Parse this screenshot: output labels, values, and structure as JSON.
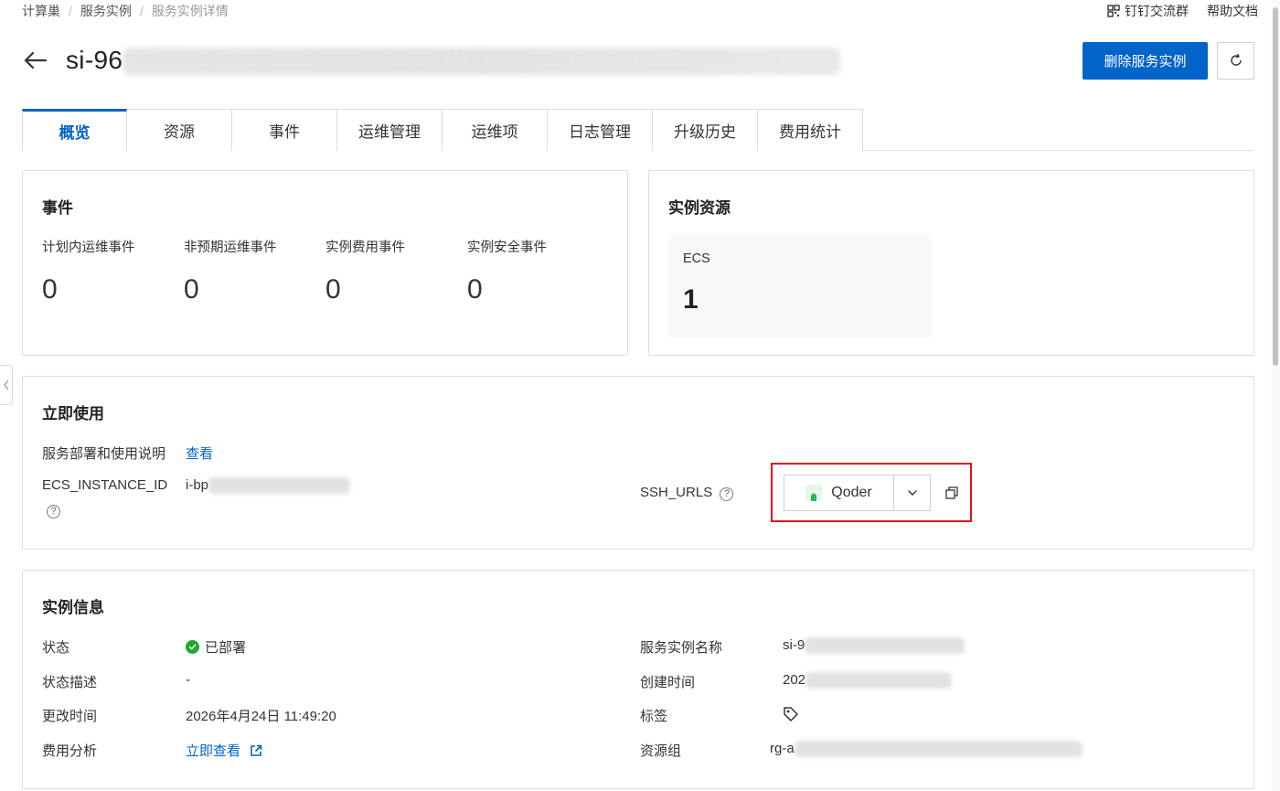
{
  "breadcrumb": {
    "items": [
      "计算巢",
      "服务实例",
      "服务实例详情"
    ]
  },
  "top_links": {
    "dingtalk": "钉钉交流群",
    "help": "帮助文档"
  },
  "header": {
    "title_prefix": "si-96",
    "delete_button": "删除服务实例"
  },
  "tabs": [
    "概览",
    "资源",
    "事件",
    "运维管理",
    "运维项",
    "日志管理",
    "升级历史",
    "费用统计"
  ],
  "events_card": {
    "title": "事件",
    "stats": [
      {
        "label": "计划内运维事件",
        "value": "0"
      },
      {
        "label": "非预期运维事件",
        "value": "0"
      },
      {
        "label": "实例费用事件",
        "value": "0"
      },
      {
        "label": "实例安全事件",
        "value": "0"
      }
    ]
  },
  "resource_card": {
    "title": "实例资源",
    "ecs_label": "ECS",
    "ecs_value": "1"
  },
  "use_card": {
    "title": "立即使用",
    "deploy_label": "服务部署和使用说明",
    "deploy_link": "查看",
    "ecs_id_label": "ECS_INSTANCE_ID",
    "ecs_id_prefix": "i-bp",
    "ssh_label": "SSH_URLS",
    "ssh_option": "Qoder",
    "help_glyph": "?"
  },
  "info_card": {
    "title": "实例信息",
    "status_label": "状态",
    "status_value": "已部署",
    "desc_label": "状态描述",
    "desc_value": "-",
    "modified_label": "更改时间",
    "modified_value": "2026年4月24日 11:49:20",
    "cost_label": "费用分析",
    "cost_link": "立即查看",
    "name_label": "服务实例名称",
    "name_prefix": "si-9",
    "created_label": "创建时间",
    "created_prefix": "202",
    "tag_label": "标签",
    "rg_label": "资源组",
    "rg_prefix": "rg-a"
  },
  "colors": {
    "primary": "#0064c8",
    "highlight": "#e0141e",
    "success": "#1fa82f"
  }
}
